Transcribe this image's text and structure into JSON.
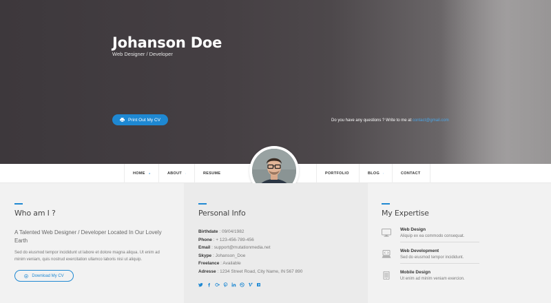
{
  "hero": {
    "name": "Johanson Doe",
    "role": "Web Designer / Developer",
    "print_button": "Print Out My CV",
    "question_text": "Do you have any questions ? Write to me at",
    "question_email": "contact@gmail.com"
  },
  "nav": {
    "items": [
      {
        "label": "HOME",
        "icon": "home-icon"
      },
      {
        "label": "ABOUT",
        "icon": "user-icon"
      },
      {
        "label": "RESUME",
        "icon": "document-icon"
      },
      {
        "label": "PORTFOLIO",
        "icon": "camera-icon"
      },
      {
        "label": "BLOG",
        "icon": "chat-icon"
      },
      {
        "label": "CONTACT",
        "icon": "paper-plane-icon"
      }
    ]
  },
  "who": {
    "title": "Who am I ?",
    "subtitle": "A Talented Web Designer / Developer Located In Our Lovely Earth",
    "body": "Sed do eiusmod tempor incididunt ut labore et dolore magna aliqua. Ut enim ad minim veniam, quis nostrud exercitation ullamco laboris nisi ut aliquip.",
    "download_button": "Download My CV"
  },
  "info": {
    "title": "Personal Info",
    "rows": [
      {
        "label": "Birthdate",
        "value": " : 09/04/1982"
      },
      {
        "label": "Phone",
        "value": " : + 123-456-789-456"
      },
      {
        "label": "Email",
        "value": " : support@mutationmedia.net"
      },
      {
        "label": "Skype",
        "value": " : Johanson_Doe"
      },
      {
        "label": "Freelance",
        "value": " : Available"
      },
      {
        "label": "Adresse",
        "value": " : 1234 Street Road, City Name, IN 567 890"
      }
    ],
    "socials": [
      "twitter-icon",
      "facebook-icon",
      "google-plus-icon",
      "pinterest-icon",
      "linkedin-icon",
      "dribbble-icon",
      "vimeo-icon",
      "tumblr-icon"
    ]
  },
  "expertise": {
    "title": "My Expertise",
    "items": [
      {
        "title": "Web Design",
        "desc": "Aliquip ex ea commodo consequat.",
        "icon": "monitor-icon"
      },
      {
        "title": "Web Development",
        "desc": "Sed do eiusmod tempor incididunt.",
        "icon": "code-icon"
      },
      {
        "title": "Mobile Design",
        "desc": "Ut enim ad minim veniam exercion.",
        "icon": "tablet-icon"
      }
    ]
  },
  "colors": {
    "accent": "#1e88d2",
    "hero_dark": "#3d383c",
    "nav_bg": "#ffffff"
  }
}
